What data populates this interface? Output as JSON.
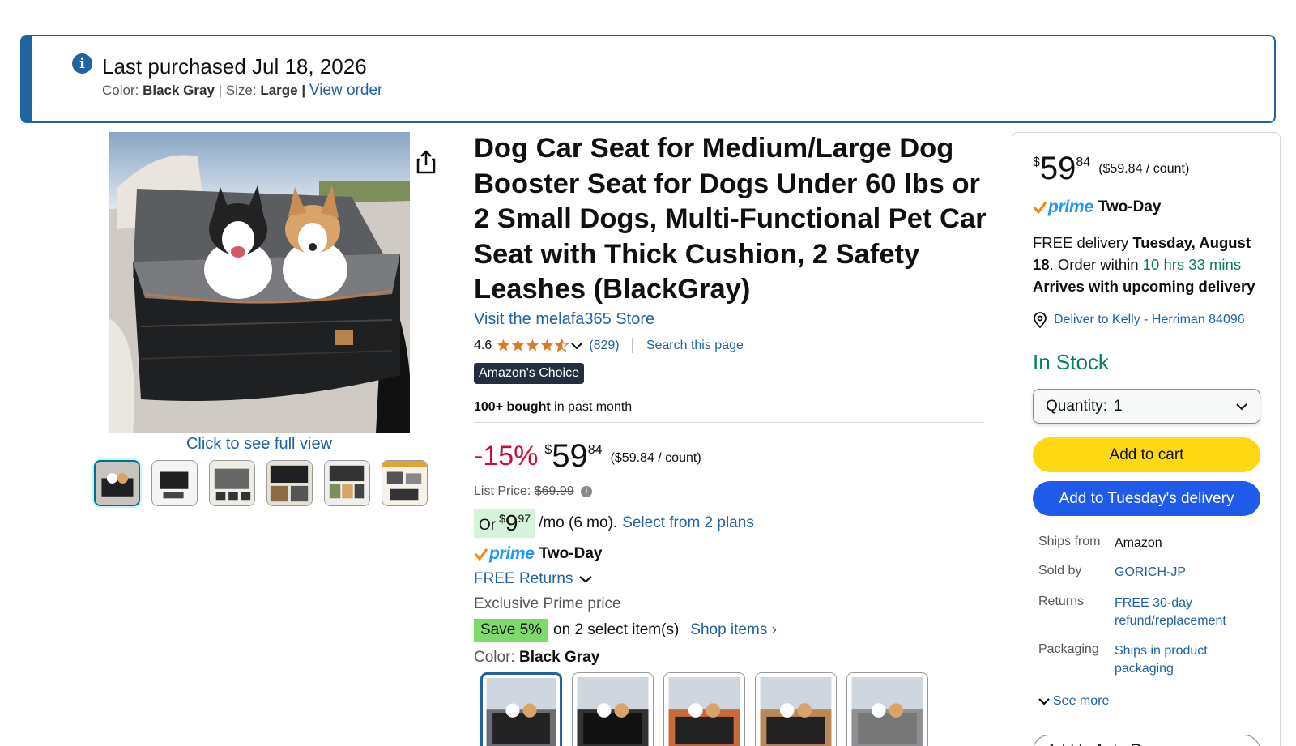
{
  "banner": {
    "title": "Last purchased Jul 18, 2026",
    "color_label": "Color:",
    "color_value": "Black Gray",
    "size_label": "Size:",
    "size_value": "Large",
    "view_order": "View order"
  },
  "gallery": {
    "full_view": "Click to see full view",
    "thumb_count": 6
  },
  "product": {
    "title": "Dog Car Seat for Medium/Large Dog Booster Seat for Dogs Under 60 lbs or 2 Small Dogs, Multi-Functional Pet Car Seat with Thick Cushion, 2 Safety Leashes (BlackGray)",
    "store": "Visit the melafa365 Store",
    "rating": "4.6",
    "rating_stars": 4.6,
    "review_count": "(829)",
    "separator": "|",
    "search_page": "Search this page",
    "badge": "Amazon's Choice",
    "bought_bold": "100+ bought",
    "bought_rest": "in past month"
  },
  "pricing": {
    "discount": "-15%",
    "currency": "$",
    "whole": "59",
    "fraction": "84",
    "per_unit": "($59.84 / count)",
    "list_label": "List Price:",
    "list_value": "$69.99",
    "monthly_or": "Or",
    "monthly_currency": "$",
    "monthly_whole": "9",
    "monthly_fraction": "97",
    "monthly_rest": "/mo (6 mo).",
    "monthly_plans": "Select from 2 plans",
    "prime_word": "prime",
    "prime_speed": "Two-Day",
    "free_returns": "FREE Returns",
    "exclusive": "Exclusive Prime price",
    "save_badge": "Save 5%",
    "save_rest": "on 2 select item(s)",
    "shop_items": "Shop items ›"
  },
  "color": {
    "label": "Color:",
    "selected": "Black Gray",
    "swatches": [
      "black-gray",
      "black",
      "orange",
      "brown",
      "gray"
    ]
  },
  "buybox": {
    "currency": "$",
    "whole": "59",
    "fraction": "84",
    "per_unit": "($59.84 / count)",
    "prime_word": "prime",
    "prime_speed": "Two-Day",
    "delivery_free": "FREE delivery",
    "delivery_date": "Tuesday, August 18",
    "delivery_order": ". Order within",
    "delivery_time": "10 hrs 33 mins",
    "delivery_upcoming": "Arrives with upcoming delivery",
    "deliver_to": "Deliver to Kelly - Herriman 84096",
    "stock": "In Stock",
    "qty_label": "Quantity:",
    "qty_value": "1",
    "add_to_cart": "Add to cart",
    "add_tuesday": "Add to Tuesday's delivery",
    "info": [
      {
        "k": "Ships from",
        "v": "Amazon",
        "link": false
      },
      {
        "k": "Sold by",
        "v": "GORICH-JP",
        "link": true
      },
      {
        "k": "Returns",
        "v": "FREE 30-day refund/replacement",
        "link": true
      },
      {
        "k": "Packaging",
        "v": "Ships in product packaging",
        "link": true
      }
    ],
    "see_more": "See more",
    "auto_replenish": "Add to Auto Re..."
  },
  "colors": {
    "link": "#2162a1",
    "deal_red": "#cc0c39",
    "stock_green": "#067d62",
    "cart_yellow": "#ffd814",
    "tuesday_blue": "#1f5aea",
    "prime_blue": "#1a98ff"
  }
}
